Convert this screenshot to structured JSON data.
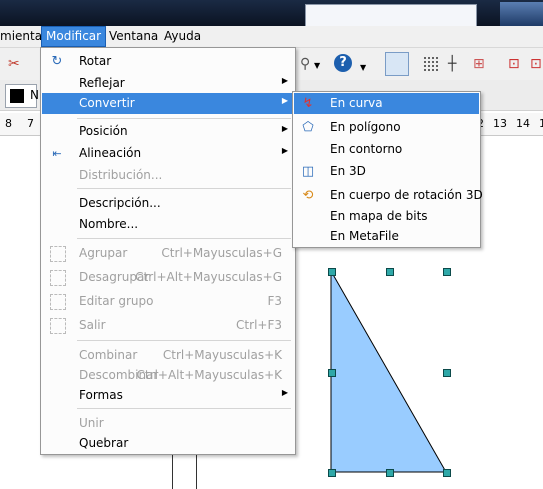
{
  "menubar": {
    "items": [
      {
        "label": "mientas"
      },
      {
        "label": "Modificar",
        "active": true
      },
      {
        "label": "Ventana"
      },
      {
        "label": "Ayuda"
      }
    ]
  },
  "toolbar": {
    "line_value": "N"
  },
  "ruler": {
    "left_numbers": [
      "8",
      "7"
    ],
    "right_numbers": [
      "12",
      "13",
      "14",
      "1"
    ]
  },
  "menu": {
    "items": [
      {
        "label": "Rotar",
        "icon": "rotate-icon",
        "enabled": true
      },
      {
        "label": "Reflejar",
        "icon": "",
        "enabled": true,
        "submenu": true
      },
      {
        "label": "Convertir",
        "icon": "",
        "enabled": true,
        "submenu": true,
        "highlighted": true
      },
      {
        "label": "Posición",
        "icon": "",
        "enabled": true,
        "submenu": true
      },
      {
        "label": "Alineación",
        "icon": "align-icon",
        "enabled": true,
        "submenu": true
      },
      {
        "label": "Distribución...",
        "icon": "",
        "enabled": false
      },
      {
        "label": "Descripción...",
        "icon": "",
        "enabled": true
      },
      {
        "label": "Nombre...",
        "icon": "",
        "enabled": true
      },
      {
        "label": "Agrupar",
        "shortcut": "Ctrl+Mayusculas+G",
        "icon": "group-icon",
        "enabled": false
      },
      {
        "label": "Desagrupar",
        "shortcut": "Ctrl+Alt+Mayusculas+G",
        "icon": "ungroup-icon",
        "enabled": false
      },
      {
        "label": "Editar grupo",
        "shortcut": "F3",
        "icon": "edit-group-icon",
        "enabled": false
      },
      {
        "label": "Salir",
        "shortcut": "Ctrl+F3",
        "icon": "exit-group-icon",
        "enabled": false
      },
      {
        "label": "Combinar",
        "shortcut": "Ctrl+Mayusculas+K",
        "icon": "",
        "enabled": false
      },
      {
        "label": "Descombinar",
        "shortcut": "Ctrl+Alt+Mayusculas+K",
        "icon": "",
        "enabled": false
      },
      {
        "label": "Formas",
        "icon": "",
        "enabled": true,
        "submenu": true
      },
      {
        "label": "Unir",
        "icon": "",
        "enabled": false
      },
      {
        "label": "Quebrar",
        "icon": "",
        "enabled": true
      }
    ]
  },
  "submenu": {
    "items": [
      {
        "label": "En curva",
        "icon": "curve-icon",
        "highlighted": true
      },
      {
        "label": "En polígono",
        "icon": "polygon-icon"
      },
      {
        "label": "En contorno",
        "icon": ""
      },
      {
        "label": "En 3D",
        "icon": "cube-3d-icon"
      },
      {
        "label": "En cuerpo de rotación 3D",
        "icon": "rotation-body-icon"
      },
      {
        "label": "En mapa de bits",
        "icon": ""
      },
      {
        "label": "En MetaFile",
        "icon": ""
      }
    ]
  },
  "colors": {
    "highlight": "#3a87de",
    "triangle_fill": "#99ccff",
    "handle": "#2fa8a8"
  }
}
